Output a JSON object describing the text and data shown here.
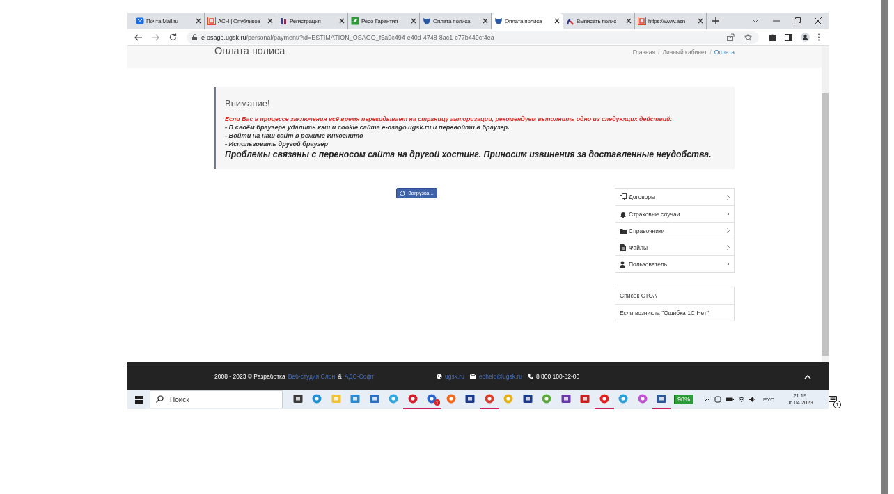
{
  "browser": {
    "tabs": [
      {
        "title": "Почта Mail.ru",
        "kind": "mail",
        "selected": false
      },
      {
        "title": "АСН | Опубликов",
        "kind": "asn",
        "selected": false
      },
      {
        "title": "Регистрация",
        "kind": "registry",
        "selected": false
      },
      {
        "title": "Ресо-Гарантия -",
        "kind": "reso",
        "selected": false
      },
      {
        "title": "Оплата полиса",
        "kind": "ugsk",
        "selected": false
      },
      {
        "title": "Оплата полиса",
        "kind": "ugsk",
        "selected": true
      },
      {
        "title": "Выписать полис",
        "kind": "arc",
        "selected": false
      },
      {
        "title": "https://www.asn-",
        "kind": "asn",
        "selected": false
      }
    ],
    "address": {
      "host": "e-osago.ugsk.ru",
      "path": "/personal/payment/?id=ESTIMATION_OSAGO_f5a9c494-e40d-4748-8ac1-c77b449cf4ea"
    }
  },
  "page": {
    "title": "Оплата полиса",
    "breadcrumbs": [
      {
        "label": "Главная",
        "selected": false
      },
      {
        "label": "Личный кабинет",
        "separator": "/",
        "selected": false
      },
      {
        "label": "Оплата",
        "separator": "/",
        "selected": true
      }
    ],
    "alert": {
      "heading": "Внимание!",
      "lines": [
        {
          "kind": "warning",
          "text": "Если Вас в процессе заключения всё время перекидывает на страницу авторизации, рекомендуем выполнить одно из следующих действий:"
        },
        {
          "kind": "item",
          "text": "- В своём браузере удалить кэш и cookie сайта e-osago.ugsk.ru и перевойти в браузер."
        },
        {
          "kind": "item",
          "text": "- Войти на наш сайт в режиме Инкогнито"
        },
        {
          "kind": "item",
          "text": "- Использовать другой браузер"
        },
        {
          "kind": "note",
          "text": "Проблемы связаны с переносом сайта на другой хостинг. Приносим извинения за доставленные неудобства."
        }
      ]
    },
    "loading_button": "Загрузка...",
    "menu": [
      {
        "label": "Договоры",
        "kind": "contracts"
      },
      {
        "label": "Страховые случаи",
        "kind": "bell"
      },
      {
        "label": "Справочники",
        "kind": "folder"
      },
      {
        "label": "Файлы",
        "kind": "file"
      },
      {
        "label": "Пользователь",
        "kind": "user"
      }
    ],
    "links": [
      "Список СТОА",
      "Если возникла \"Ошибка 1С Нет\""
    ],
    "footer": {
      "copyright": "2008 - 2023 © Разработка",
      "studio_link": "Веб-студия Слон",
      "ampersand": "&",
      "soft_link": "АДС-Софт",
      "site_link": "ugsk.ru",
      "email_link": "eohelp@ugsk.ru",
      "phone": "8 800 100-82-00"
    }
  },
  "taskbar": {
    "search": {
      "placeholder": "Поиск"
    },
    "apps": [
      {
        "kind": "taskview",
        "open": false
      },
      {
        "kind": "edge",
        "open": false
      },
      {
        "kind": "explorer",
        "open": false
      },
      {
        "kind": "l",
        "open": false
      },
      {
        "kind": "mailapp",
        "open": false
      },
      {
        "kind": "ie",
        "open": false
      },
      {
        "kind": "opera",
        "open": true
      },
      {
        "kind": "messenger",
        "open": true,
        "badge": "1"
      },
      {
        "kind": "firefox",
        "open": false
      },
      {
        "kind": "disk",
        "open": false
      },
      {
        "kind": "chrome",
        "open": true
      },
      {
        "kind": "player",
        "open": false
      },
      {
        "kind": "disk",
        "open": false
      },
      {
        "kind": "torrent",
        "open": false
      },
      {
        "kind": "studio",
        "open": false
      },
      {
        "kind": "pdf",
        "open": false
      },
      {
        "kind": "yandex",
        "open": true
      },
      {
        "kind": "telegram",
        "open": false
      },
      {
        "kind": "gem",
        "open": false
      },
      {
        "kind": "word",
        "open": true
      }
    ],
    "battery": "98%",
    "language": "РУС",
    "time": "21:19",
    "date": "06.04.2023",
    "notifications": "1"
  }
}
